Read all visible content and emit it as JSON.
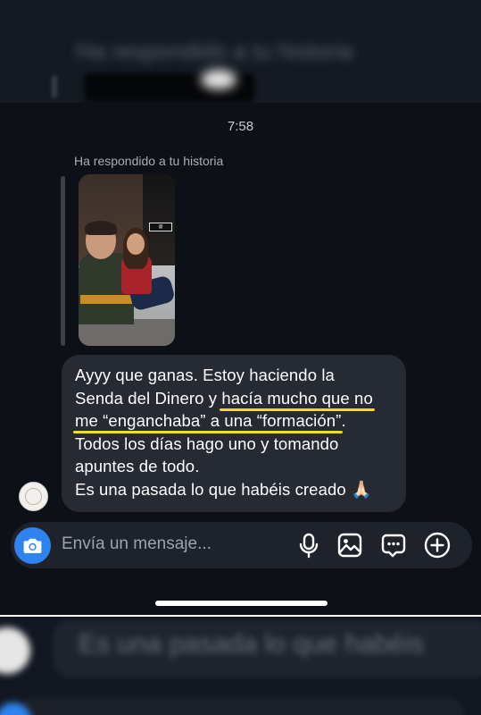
{
  "background_previous": {
    "text": "Ha respondido a tu historia"
  },
  "thread": {
    "timestamp": "7:58",
    "story_reply_label": "Ha respondido a tu historia",
    "story_tag": "@",
    "message": {
      "line1": "Ayyy que ganas. Estoy haciendo la",
      "line2_pre": "Senda del Dinero y ",
      "line2_hl": "hacía mucho que no",
      "line3_hl": "me “enganchaba” a una “formación”",
      "line3_post": ".",
      "line4": "Todos los días hago uno y tomando",
      "line5": "apuntes de todo.",
      "line6": "Es una pasada lo que habéis creado",
      "emoji": "🙏🏻"
    }
  },
  "composer": {
    "placeholder": "Envía un mensaje..."
  },
  "background_next": {
    "text": "Es una pasada lo que habéis"
  },
  "colors": {
    "accent_camera": "#2f83f0",
    "highlight": "#f2dd1a",
    "bubble": "#262b33"
  }
}
